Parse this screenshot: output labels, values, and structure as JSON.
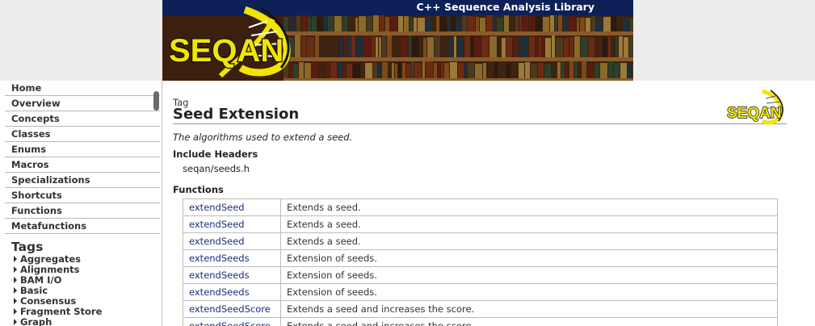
{
  "banner": {
    "title": "C++ Sequence Analysis Library",
    "logo_text": "SEQAN"
  },
  "sidebar": {
    "nav": [
      {
        "label": "Home"
      },
      {
        "label": "Overview"
      },
      {
        "label": "Concepts"
      },
      {
        "label": "Classes"
      },
      {
        "label": "Enums"
      },
      {
        "label": "Macros"
      },
      {
        "label": "Specializations"
      },
      {
        "label": "Shortcuts"
      },
      {
        "label": "Functions"
      },
      {
        "label": "Metafunctions"
      }
    ],
    "tags_heading": "Tags",
    "tags": [
      {
        "label": "Aggregates"
      },
      {
        "label": "Alignments"
      },
      {
        "label": "BAM I/O"
      },
      {
        "label": "Basic"
      },
      {
        "label": "Consensus"
      },
      {
        "label": "Fragment Store"
      },
      {
        "label": "Graph"
      }
    ]
  },
  "main": {
    "kind": "Tag",
    "title": "Seed Extension",
    "logo_text": "SEQAN",
    "summary": "The algorithms used to extend a seed.",
    "include_headers_heading": "Include Headers",
    "include_header_file": "seqan/seeds.h",
    "functions_heading": "Functions",
    "functions": [
      {
        "name": "extendSeed",
        "desc": "Extends a seed."
      },
      {
        "name": "extendSeed",
        "desc": "Extends a seed."
      },
      {
        "name": "extendSeed",
        "desc": "Extends a seed."
      },
      {
        "name": "extendSeeds",
        "desc": "Extension of seeds."
      },
      {
        "name": "extendSeeds",
        "desc": "Extension of seeds."
      },
      {
        "name": "extendSeeds",
        "desc": "Extension of seeds."
      },
      {
        "name": "extendSeedScore",
        "desc": "Extends a seed and increases the score."
      },
      {
        "name": "extendSeedScore",
        "desc": "Extends a seed and increases the score."
      }
    ]
  },
  "colors": {
    "banner_strip": "#0d2157",
    "link": "#1d2d7a",
    "logo_yellow": "#f2e500"
  }
}
